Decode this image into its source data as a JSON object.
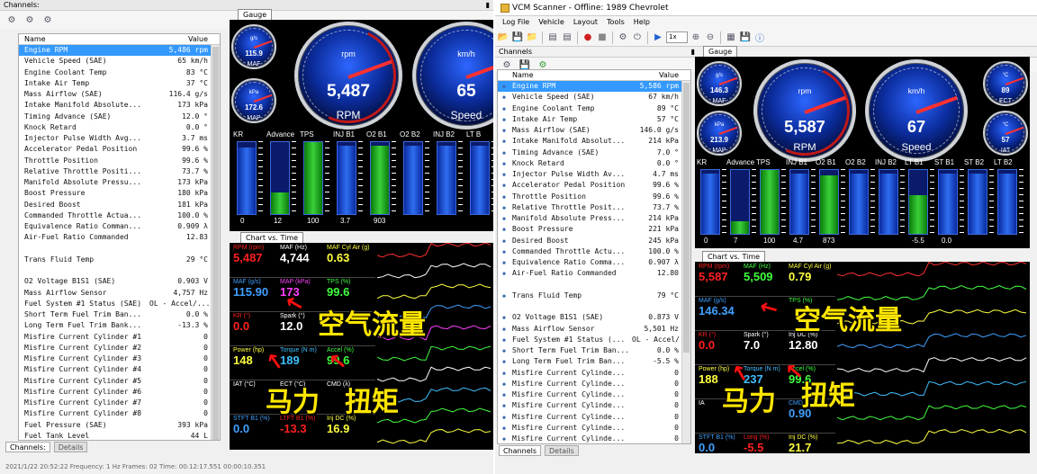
{
  "left": {
    "channels_title": "Channels:",
    "pin": "੪",
    "col_name": "Name",
    "col_value": "Value",
    "rows": [
      {
        "name": "Engine RPM",
        "value": "5,486 rpm"
      },
      {
        "name": "Vehicle Speed (SAE)",
        "value": "65 km/h"
      },
      {
        "name": "Engine Coolant Temp",
        "value": "83 °C"
      },
      {
        "name": "Intake Air Temp",
        "value": "37 °C"
      },
      {
        "name": "Mass Airflow (SAE)",
        "value": "116.4 g/s"
      },
      {
        "name": "Intake Manifold Absolute...",
        "value": "173 kPa"
      },
      {
        "name": "Timing Advance (SAE)",
        "value": "12.0 °"
      },
      {
        "name": "Knock Retard",
        "value": "0.0 °"
      },
      {
        "name": "Injector Pulse Width Avg...",
        "value": "3.7 ms"
      },
      {
        "name": "Accelerator Pedal Position",
        "value": "99.6 %"
      },
      {
        "name": "Throttle Position",
        "value": "99.6 %"
      },
      {
        "name": "Relative Throttle Positi...",
        "value": "73.7 %"
      },
      {
        "name": "Manifold Absolute Pressu...",
        "value": "173 kPa"
      },
      {
        "name": "Boost Pressure",
        "value": "180 kPa"
      },
      {
        "name": "Desired Boost",
        "value": "181 kPa"
      },
      {
        "name": "Commanded Throttle Actua...",
        "value": "100.0 %"
      },
      {
        "name": "Equivalence Ratio Comman...",
        "value": "0.909 λ"
      },
      {
        "name": "Air-Fuel Ratio Commanded",
        "value": "12.83"
      },
      {
        "name": "",
        "value": ""
      },
      {
        "name": "Trans Fluid Temp",
        "value": "29 °C"
      },
      {
        "name": "",
        "value": ""
      },
      {
        "name": "O2 Voltage B1S1 (SAE)",
        "value": "0.903 V"
      },
      {
        "name": "Mass Airflow Sensor",
        "value": "4,757 Hz"
      },
      {
        "name": "Fuel System #1 Status (SAE)",
        "value": "OL - Accel/..."
      },
      {
        "name": "Short Term Fuel Trim Ban...",
        "value": "0.0 %"
      },
      {
        "name": "Long Term Fuel Trim Bank...",
        "value": "-13.3 %"
      },
      {
        "name": "Misfire Current Cylinder #1",
        "value": "0"
      },
      {
        "name": "Misfire Current Cylinder #2",
        "value": "0"
      },
      {
        "name": "Misfire Current Cylinder #3",
        "value": "0"
      },
      {
        "name": "Misfire Current Cylinder #4",
        "value": "0"
      },
      {
        "name": "Misfire Current Cylinder #5",
        "value": "0"
      },
      {
        "name": "Misfire Current Cylinder #6",
        "value": "0"
      },
      {
        "name": "Misfire Current Cylinder #7",
        "value": "0"
      },
      {
        "name": "Misfire Current Cylinder #8",
        "value": "0"
      },
      {
        "name": "Fuel Pressure (SAE)",
        "value": "393 kPa"
      },
      {
        "name": "Fuel Tank Level",
        "value": "44 L"
      }
    ],
    "bottom_tabs": {
      "channels": "Channels:",
      "details": "Details"
    },
    "gauge_tab": "Gauge",
    "chart_tab": "Chart vs. Time",
    "gauges": {
      "maf": {
        "unit": "g/s",
        "value": "115.9",
        "name": "MAF"
      },
      "map": {
        "unit": "kPa",
        "value": "172.6",
        "name": "MAP"
      },
      "rpm": {
        "unit": "rpm",
        "value": "5,487",
        "name": "RPM"
      },
      "speed": {
        "unit": "km/h",
        "value": "65",
        "name": "Speed"
      }
    },
    "bars": {
      "labels": [
        "KR",
        "Advance",
        "TPS",
        "INJ B1",
        "O2 B1",
        "O2 B2",
        "INJ B2",
        "LT B"
      ],
      "values": [
        "0",
        "12",
        "100",
        "3.7",
        "903",
        "",
        "",
        ""
      ],
      "scale_top": "15"
    },
    "cells": [
      {
        "label": "RPM (rpm)",
        "value": "5,487",
        "color": "#ff2020"
      },
      {
        "label": "MAF (Hz)",
        "value": "4,744",
        "color": "#ffffff"
      },
      {
        "label": "MAF Cyl Air (g)",
        "value": "0.63",
        "color": "#ffff40"
      },
      {
        "label": "MAF (g/s)",
        "value": "115.90",
        "color": "#40a0ff"
      },
      {
        "label": "MAP (kPa)",
        "value": "173",
        "color": "#ff40ff"
      },
      {
        "label": "TPS (%)",
        "value": "99.6",
        "color": "#40ff40"
      },
      {
        "label": "KR (°)",
        "value": "0.0",
        "color": "#ff2020"
      },
      {
        "label": "Spark (°)",
        "value": "12.0",
        "color": "#ffffff"
      },
      {
        "label": "",
        "value": "",
        "color": "#ffffff"
      },
      {
        "label": "Power (hp)",
        "value": "148",
        "color": "#ffff40"
      },
      {
        "label": "Torque (N m)",
        "value": "189",
        "color": "#40c0ff"
      },
      {
        "label": "Accel (%)",
        "value": "99.6",
        "color": "#40ff40"
      },
      {
        "label": "IAT (°C)",
        "value": "",
        "color": "#ffffff"
      },
      {
        "label": "ECT (°C)",
        "value": "",
        "color": "#ffffff"
      },
      {
        "label": "CMD (λ)",
        "value": "",
        "color": "#ffffff"
      },
      {
        "label": "STFT B1 (%)",
        "value": "0.0",
        "color": "#40a0ff"
      },
      {
        "label": "LTFT B1 (%)",
        "value": "-13.3",
        "color": "#ff2020"
      },
      {
        "label": "Inj DC (%)",
        "value": "16.9",
        "color": "#ffff40"
      }
    ],
    "annot_airflow": "空气流量",
    "annot_power": "马力",
    "annot_torque": "扭矩",
    "status": "2021/1/22 20:52:22     Frequency: 1  Hz     Frames: 02     Time: 00:12:17.551  00:00:10.351"
  },
  "right": {
    "title": "VCM Scanner - Offline: 1989 Chevrolet",
    "menu": [
      "Log File",
      "Vehicle",
      "Layout",
      "Tools",
      "Help"
    ],
    "rate": "1x",
    "channels_title": "Channels",
    "col_name": "Name",
    "col_value": "Value",
    "rows": [
      {
        "name": "Engine RPM",
        "value": "5,586 rpm"
      },
      {
        "name": "Vehicle Speed (SAE)",
        "value": "67 km/h"
      },
      {
        "name": "Engine Coolant Temp",
        "value": "89 °C"
      },
      {
        "name": "Intake Air Temp",
        "value": "57 °C"
      },
      {
        "name": "Mass Airflow (SAE)",
        "value": "146.0 g/s"
      },
      {
        "name": "Intake Manifold Absolut...",
        "value": "214 kPa"
      },
      {
        "name": "Timing Advance (SAE)",
        "value": "7.0 °"
      },
      {
        "name": "Knock Retard",
        "value": "0.0 °"
      },
      {
        "name": "Injector Pulse Width Av...",
        "value": "4.7 ms"
      },
      {
        "name": "Accelerator Pedal Position",
        "value": "99.6 %"
      },
      {
        "name": "Throttle Position",
        "value": "99.6 %"
      },
      {
        "name": "Relative Throttle Posit...",
        "value": "73.7 %"
      },
      {
        "name": "Manifold Absolute Press...",
        "value": "214 kPa"
      },
      {
        "name": "Boost Pressure",
        "value": "221 kPa"
      },
      {
        "name": "Desired Boost",
        "value": "245 kPa"
      },
      {
        "name": "Commanded Throttle Actu...",
        "value": "100.0 %"
      },
      {
        "name": "Equivalence Ratio Comma...",
        "value": "0.907 λ"
      },
      {
        "name": "Air-Fuel Ratio Commanded",
        "value": "12.80"
      },
      {
        "name": "",
        "value": ""
      },
      {
        "name": "Trans Fluid Temp",
        "value": "79 °C"
      },
      {
        "name": "",
        "value": ""
      },
      {
        "name": "O2 Voltage B1S1 (SAE)",
        "value": "0.873 V"
      },
      {
        "name": "Mass Airflow Sensor",
        "value": "5,501 Hz"
      },
      {
        "name": "Fuel System #1 Status (...",
        "value": "OL - Accel/..."
      },
      {
        "name": "Short Term Fuel Trim Ban...",
        "value": "0.0 %"
      },
      {
        "name": "Long Term Fuel Trim Ban...",
        "value": "-5.5 %"
      },
      {
        "name": "Misfire Current Cylinde...",
        "value": "0"
      },
      {
        "name": "Misfire Current Cylinde...",
        "value": "0"
      },
      {
        "name": "Misfire Current Cylinde...",
        "value": "0"
      },
      {
        "name": "Misfire Current Cylinde...",
        "value": "0"
      },
      {
        "name": "Misfire Current Cylinde...",
        "value": "0"
      },
      {
        "name": "Misfire Current Cylinde...",
        "value": "0"
      },
      {
        "name": "Misfire Current Cylinde...",
        "value": "0"
      },
      {
        "name": "Misfire Current Cylinde...",
        "value": "0"
      },
      {
        "name": "Fuel Pressure (SAE)",
        "value": "381 kPa"
      },
      {
        "name": "Fuel Tank Level",
        "value": "39 L"
      }
    ],
    "bottom_tabs": {
      "channels": "Channels",
      "details": "Details"
    },
    "gauge_tab": "Gauge",
    "chart_tab": "Chart vs. Time",
    "gauges": {
      "maf": {
        "unit": "g/s",
        "value": "146.3",
        "name": "MAF"
      },
      "map": {
        "unit": "kPa",
        "value": "213.9",
        "name": "MAP"
      },
      "rpm": {
        "unit": "rpm",
        "value": "5,587",
        "name": "RPM"
      },
      "speed": {
        "unit": "km/h",
        "value": "67",
        "name": "Speed"
      },
      "ect": {
        "unit": "°C",
        "value": "89",
        "name": "ECT"
      },
      "iat": {
        "unit": "°C",
        "value": "57",
        "name": "IAT"
      }
    },
    "bars": {
      "labels": [
        "KR",
        "Advance",
        "TPS",
        "INJ B1",
        "O2 B1",
        "O2 B2",
        "INJ B2",
        "LT B1",
        "ST B1",
        "ST B2",
        "LT B2"
      ],
      "values": [
        "0",
        "7",
        "100",
        "4.7",
        "873",
        "",
        "",
        "-5.5",
        "0.0",
        "",
        ""
      ]
    },
    "cells": [
      {
        "label": "RPM (rpm)",
        "value": "5,587",
        "color": "#ff2020"
      },
      {
        "label": "MAF (Hz)",
        "value": "5,509",
        "color": "#40ff40"
      },
      {
        "label": "MAF Cyl Air (g)",
        "value": "0.79",
        "color": "#ffff40"
      },
      {
        "label": "MAF (g/s)",
        "value": "146.34",
        "color": "#40a0ff"
      },
      {
        "label": "",
        "value": "",
        "color": "#ff40ff"
      },
      {
        "label": "TPS (%)",
        "value": "",
        "color": "#40ff40"
      },
      {
        "label": "KR (°)",
        "value": "0.0",
        "color": "#ff2020"
      },
      {
        "label": "Spark (°)",
        "value": "7.0",
        "color": "#ffffff"
      },
      {
        "label": "Inj DC (%)",
        "value": "12.80",
        "color": "#ffffff"
      },
      {
        "label": "Power (hp)",
        "value": "188",
        "color": "#ffff40"
      },
      {
        "label": "Torque (N m)",
        "value": "237",
        "color": "#40c0ff"
      },
      {
        "label": "Accel (%)",
        "value": "99.6",
        "color": "#40ff40"
      },
      {
        "label": "IA",
        "value": "",
        "color": "#ffffff"
      },
      {
        "label": "",
        "value": "",
        "color": "#ffffff"
      },
      {
        "label": "CMD",
        "value": "0.90",
        "color": "#40a0ff"
      },
      {
        "label": "STFT B1 (%)",
        "value": "0.0",
        "color": "#40a0ff"
      },
      {
        "label": "Long (%)",
        "value": "-5.5",
        "color": "#ff2020"
      },
      {
        "label": "Inj DC (%)",
        "value": "21.7",
        "color": "#ffff40"
      }
    ],
    "annot_airflow": "空气流量",
    "annot_power": "马力",
    "annot_torque": "扭矩"
  }
}
